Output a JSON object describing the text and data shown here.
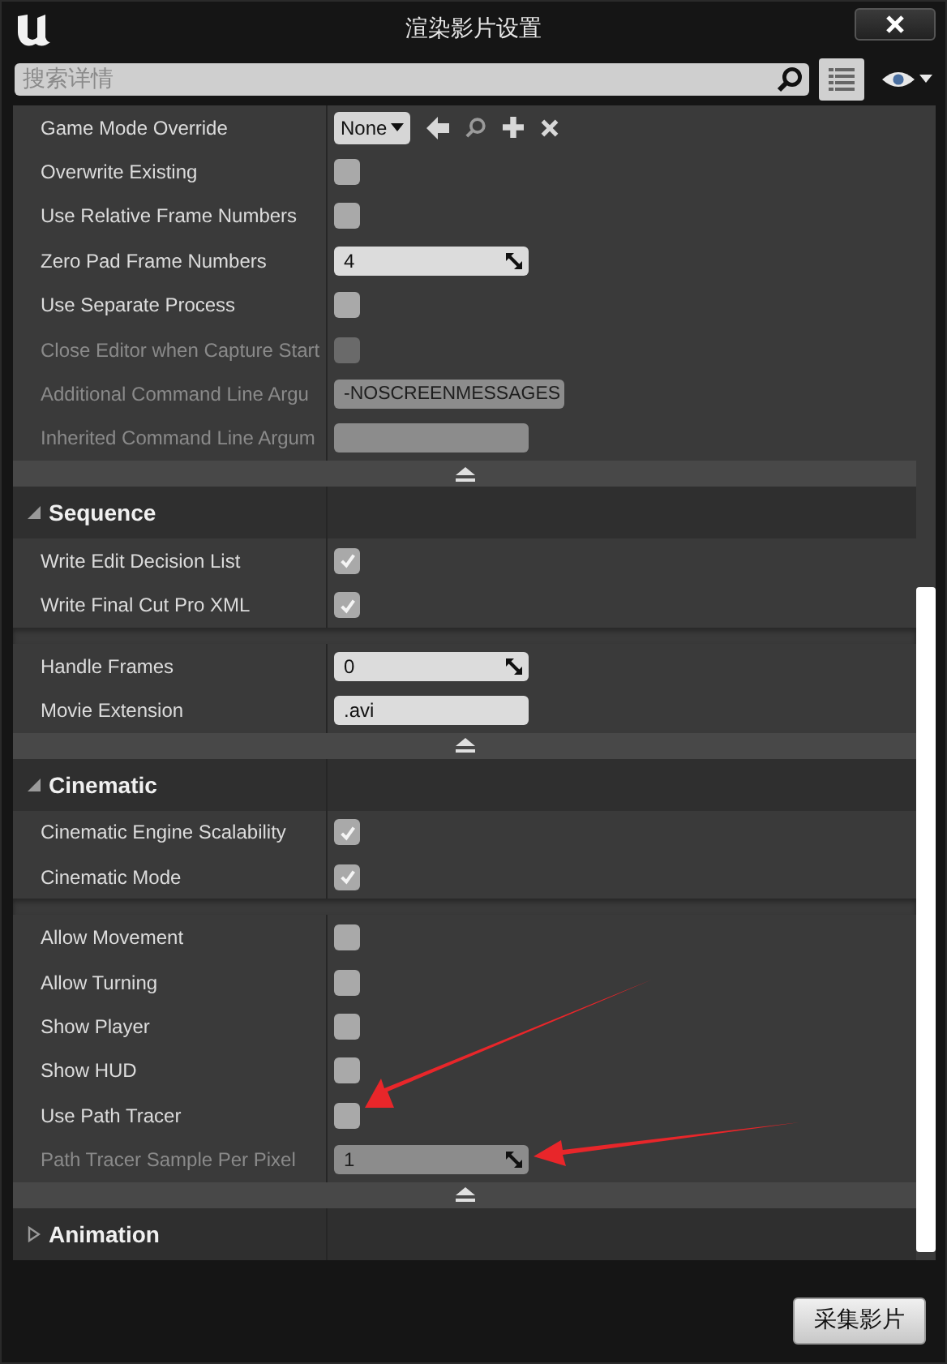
{
  "window": {
    "title": "渲染影片设置"
  },
  "search": {
    "placeholder": "搜索详情"
  },
  "sections": [
    {
      "groups": [
        {
          "rows": [
            {
              "kind": "class_picker",
              "label": "Game Mode Override",
              "value": "None",
              "disabled": false
            },
            {
              "kind": "checkbox",
              "label": "Overwrite Existing",
              "checked": false,
              "disabled": false
            },
            {
              "kind": "checkbox",
              "label": "Use Relative Frame Numbers",
              "checked": false,
              "disabled": false
            },
            {
              "kind": "number",
              "label": "Zero Pad Frame Numbers",
              "value": "4",
              "disabled": false
            },
            {
              "kind": "checkbox",
              "label": "Use Separate Process",
              "checked": false,
              "disabled": false
            },
            {
              "kind": "checkbox",
              "label": "Close Editor when Capture Start",
              "checked": false,
              "disabled": true
            },
            {
              "kind": "text",
              "label": "Additional Command Line Argu",
              "value": "-NOSCREENMESSAGES",
              "disabled": true
            },
            {
              "kind": "text",
              "label": "Inherited Command Line Argum",
              "disabled": true
            }
          ]
        }
      ]
    },
    {
      "title": "Sequence",
      "expanded": true,
      "groups": [
        {
          "rows": [
            {
              "kind": "checkbox",
              "label": "Write Edit Decision List",
              "checked": true,
              "disabled": false
            },
            {
              "kind": "checkbox",
              "label": "Write Final Cut Pro XML",
              "checked": true,
              "disabled": false
            }
          ]
        },
        {
          "rows": [
            {
              "kind": "number",
              "label": "Handle Frames",
              "value": "0",
              "disabled": false
            },
            {
              "kind": "text",
              "label": "Movie Extension",
              "value": ".avi",
              "disabled": false
            }
          ]
        }
      ]
    },
    {
      "title": "Cinematic",
      "expanded": true,
      "groups": [
        {
          "rows": [
            {
              "kind": "checkbox",
              "label": "Cinematic Engine Scalability",
              "checked": true,
              "disabled": false
            },
            {
              "kind": "checkbox",
              "label": "Cinematic Mode",
              "checked": true,
              "disabled": false
            }
          ]
        },
        {
          "rows": [
            {
              "kind": "checkbox",
              "label": "Allow Movement",
              "checked": false,
              "disabled": false
            },
            {
              "kind": "checkbox",
              "label": "Allow Turning",
              "checked": false,
              "disabled": false
            },
            {
              "kind": "checkbox",
              "label": "Show Player",
              "checked": false,
              "disabled": false
            },
            {
              "kind": "checkbox",
              "label": "Show HUD",
              "checked": false,
              "disabled": false
            },
            {
              "kind": "checkbox",
              "label": "Use Path Tracer",
              "checked": false,
              "disabled": false
            },
            {
              "kind": "number",
              "label": "Path Tracer Sample Per Pixel",
              "value": "1",
              "disabled": true
            }
          ]
        }
      ]
    },
    {
      "title": "Animation",
      "expanded": false
    }
  ],
  "footer": {
    "button": "采集影片"
  }
}
